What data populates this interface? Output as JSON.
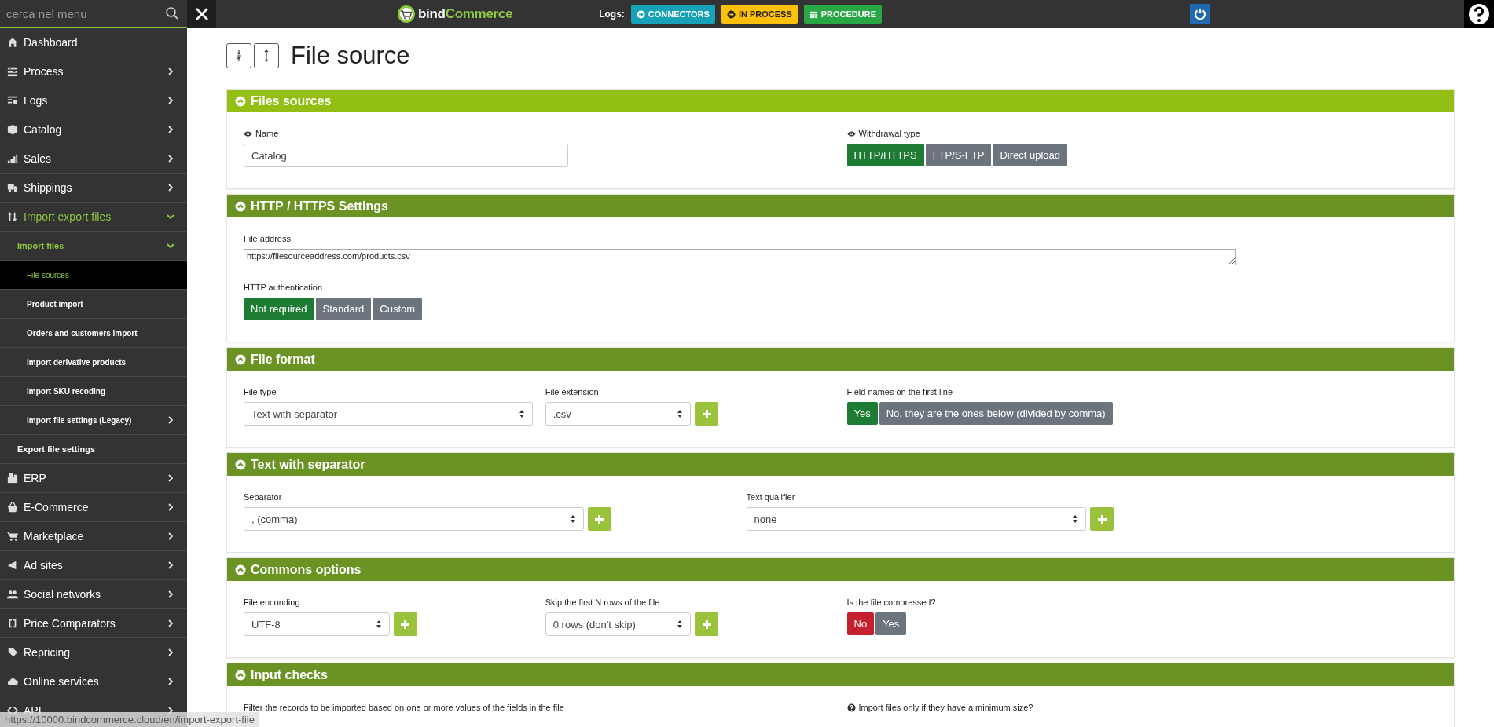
{
  "topbar": {
    "search": {
      "placeholder": "cerca nel menu"
    },
    "logo": {
      "first": "bind",
      "second": "Commerce"
    },
    "logs_label": "Logs:",
    "log_buttons": [
      {
        "label": "CONNECTORS",
        "kind": "connectors",
        "color": "#17a2b8"
      },
      {
        "label": "IN PROCESS",
        "kind": "in_process",
        "color": "#ffc107"
      },
      {
        "label": "PROCEDURE",
        "kind": "procedure",
        "color": "#28a745"
      }
    ]
  },
  "sidebar": {
    "items": [
      {
        "label": "Dashboard",
        "kind": "leaf",
        "selected": false
      },
      {
        "label": "Process",
        "kind": "branch",
        "expanded": false,
        "selected": false
      },
      {
        "label": "Logs",
        "kind": "branch",
        "expanded": false,
        "selected": false
      },
      {
        "label": "Catalog",
        "kind": "branch",
        "expanded": false,
        "selected": false
      },
      {
        "label": "Sales",
        "kind": "branch",
        "expanded": false,
        "selected": false
      },
      {
        "label": "Shippings",
        "kind": "branch",
        "expanded": false,
        "selected": false
      },
      {
        "label": "Import export files",
        "kind": "branch",
        "expanded": true,
        "selected": false,
        "children": [
          {
            "label": "Import files",
            "kind": "branch",
            "expanded": true,
            "selected": false,
            "children": [
              {
                "label": "File sources",
                "kind": "leaf",
                "selected": true
              },
              {
                "label": "Product import",
                "kind": "leaf",
                "selected": false
              },
              {
                "label": "Orders and customers import",
                "kind": "leaf",
                "selected": false
              },
              {
                "label": "Import derivative products",
                "kind": "leaf",
                "selected": false
              },
              {
                "label": "Import SKU recoding",
                "kind": "leaf",
                "selected": false
              },
              {
                "label": "Import file settings (Legacy)",
                "kind": "branch",
                "expanded": false,
                "selected": false
              }
            ]
          },
          {
            "label": "Export file settings",
            "kind": "leaf",
            "selected": false
          }
        ]
      },
      {
        "label": "ERP",
        "kind": "branch",
        "expanded": false,
        "selected": false
      },
      {
        "label": "E-Commerce",
        "kind": "branch",
        "expanded": false,
        "selected": false
      },
      {
        "label": "Marketplace",
        "kind": "branch",
        "expanded": false,
        "selected": false
      },
      {
        "label": "Ad sites",
        "kind": "branch",
        "expanded": false,
        "selected": false
      },
      {
        "label": "Social networks",
        "kind": "branch",
        "expanded": false,
        "selected": false
      },
      {
        "label": "Price Comparators",
        "kind": "branch",
        "expanded": false,
        "selected": false
      },
      {
        "label": "Repricing",
        "kind": "branch",
        "expanded": false,
        "selected": false
      },
      {
        "label": "Online services",
        "kind": "branch",
        "expanded": false,
        "selected": false
      },
      {
        "label": "API",
        "kind": "branch",
        "expanded": false,
        "selected": false
      }
    ]
  },
  "page": {
    "title": "File source"
  },
  "sections": [
    {
      "title": "Files sources",
      "highlighted": true,
      "fields": [
        {
          "kind": "text",
          "label": "Name",
          "label_icon": {
            "kind": "eye"
          },
          "value": "Catalog"
        },
        {
          "kind": "choice",
          "label": "Withdrawal type",
          "label_icon": {
            "kind": "eye"
          },
          "color": "#1e7b34",
          "options": [
            {
              "label": "HTTP/HTTPS",
              "selected": true
            },
            {
              "label": "FTP/S-FTP",
              "selected": false
            },
            {
              "label": "Direct upload",
              "selected": false
            }
          ]
        }
      ]
    },
    {
      "title": "HTTP / HTTPS Settings",
      "highlighted": false,
      "fields": [
        {
          "kind": "textarea",
          "label": "File address",
          "value": "https://filesourceaddress.com/products.csv"
        },
        {
          "kind": "choice",
          "label": "HTTP authentication",
          "color": "#1e7b34",
          "options": [
            {
              "label": "Not required",
              "selected": true
            },
            {
              "label": "Standard",
              "selected": false
            },
            {
              "label": "Custom",
              "selected": false
            }
          ]
        }
      ]
    },
    {
      "title": "File format",
      "highlighted": false,
      "fields": [
        {
          "kind": "select",
          "label": "File type",
          "value": "Text with separator",
          "add_button": false
        },
        {
          "kind": "select",
          "label": "File extension",
          "value": ".csv",
          "add_button": true
        },
        {
          "kind": "choice",
          "label": "Field names on the first line",
          "color": "#1e7b34",
          "options": [
            {
              "label": "Yes",
              "selected": true
            },
            {
              "label": "No, they are the ones below (divided by comma)",
              "selected": false
            }
          ]
        }
      ]
    },
    {
      "title": "Text with separator",
      "highlighted": false,
      "fields": [
        {
          "kind": "select",
          "label": "Separator",
          "value": ", (comma)",
          "add_button": true
        },
        {
          "kind": "select",
          "label": "Text qualifier",
          "value": "none",
          "add_button": true
        }
      ]
    },
    {
      "title": "Commons options",
      "highlighted": false,
      "fields": [
        {
          "kind": "select",
          "label": "File enconding",
          "value": "UTF-8",
          "add_button": true
        },
        {
          "kind": "select",
          "label": "Skip the first N rows of the file",
          "value": "0 rows (don't skip)",
          "add_button": true
        },
        {
          "kind": "choice",
          "label": "Is the file compressed?",
          "color": "#c4202f",
          "options": [
            {
              "label": "No",
              "selected": true
            },
            {
              "label": "Yes",
              "selected": false
            }
          ]
        }
      ]
    },
    {
      "title": "Input checks",
      "highlighted": false,
      "fields": [
        {
          "kind": "label",
          "label": "Filter the records to be imported based on one or more values of the fields in the file"
        },
        {
          "kind": "label",
          "label": "Import files only if they have a minimum size?",
          "label_icon": {
            "kind": "help"
          }
        }
      ]
    }
  ],
  "status_bar": {
    "url": "https://10000.bindcommerce.cloud/en/import-export-file"
  }
}
